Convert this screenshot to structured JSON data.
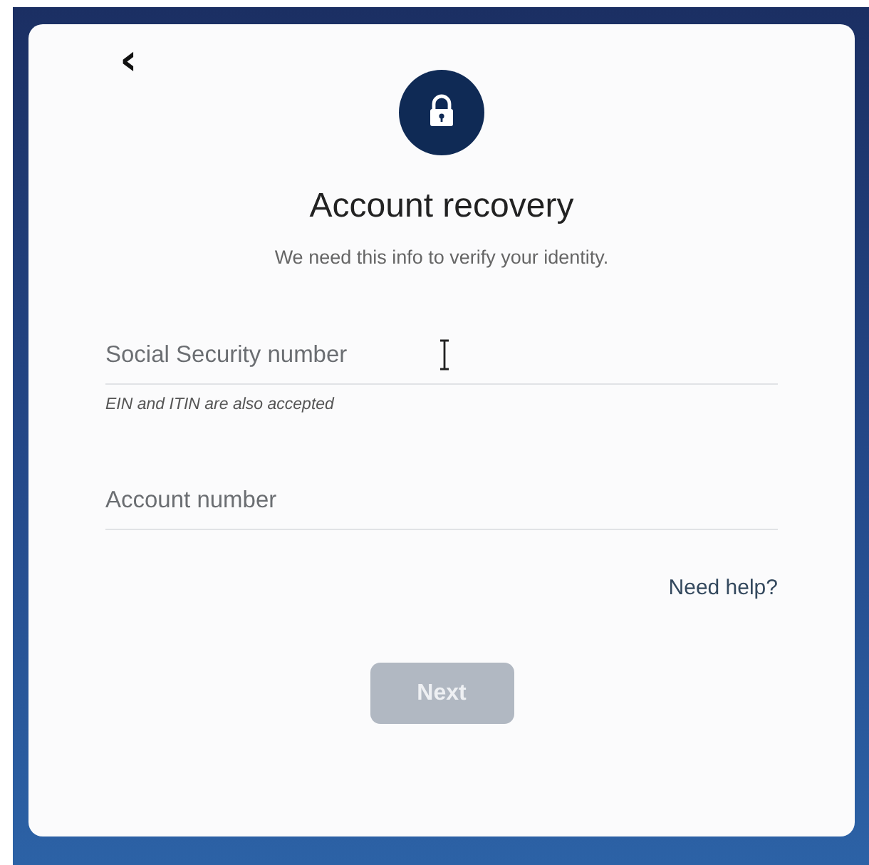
{
  "header": {
    "back": "‹",
    "title": "Account recovery",
    "subtitle": "We need this info to verify your identity."
  },
  "fields": [
    {
      "placeholder": "Social Security number",
      "hint": "EIN and ITIN are also accepted",
      "cursor": true
    },
    {
      "placeholder": "Account number",
      "cursor": false
    }
  ],
  "help_link": "Need help?",
  "next_button": {
    "label": "Next",
    "disabled": true
  }
}
